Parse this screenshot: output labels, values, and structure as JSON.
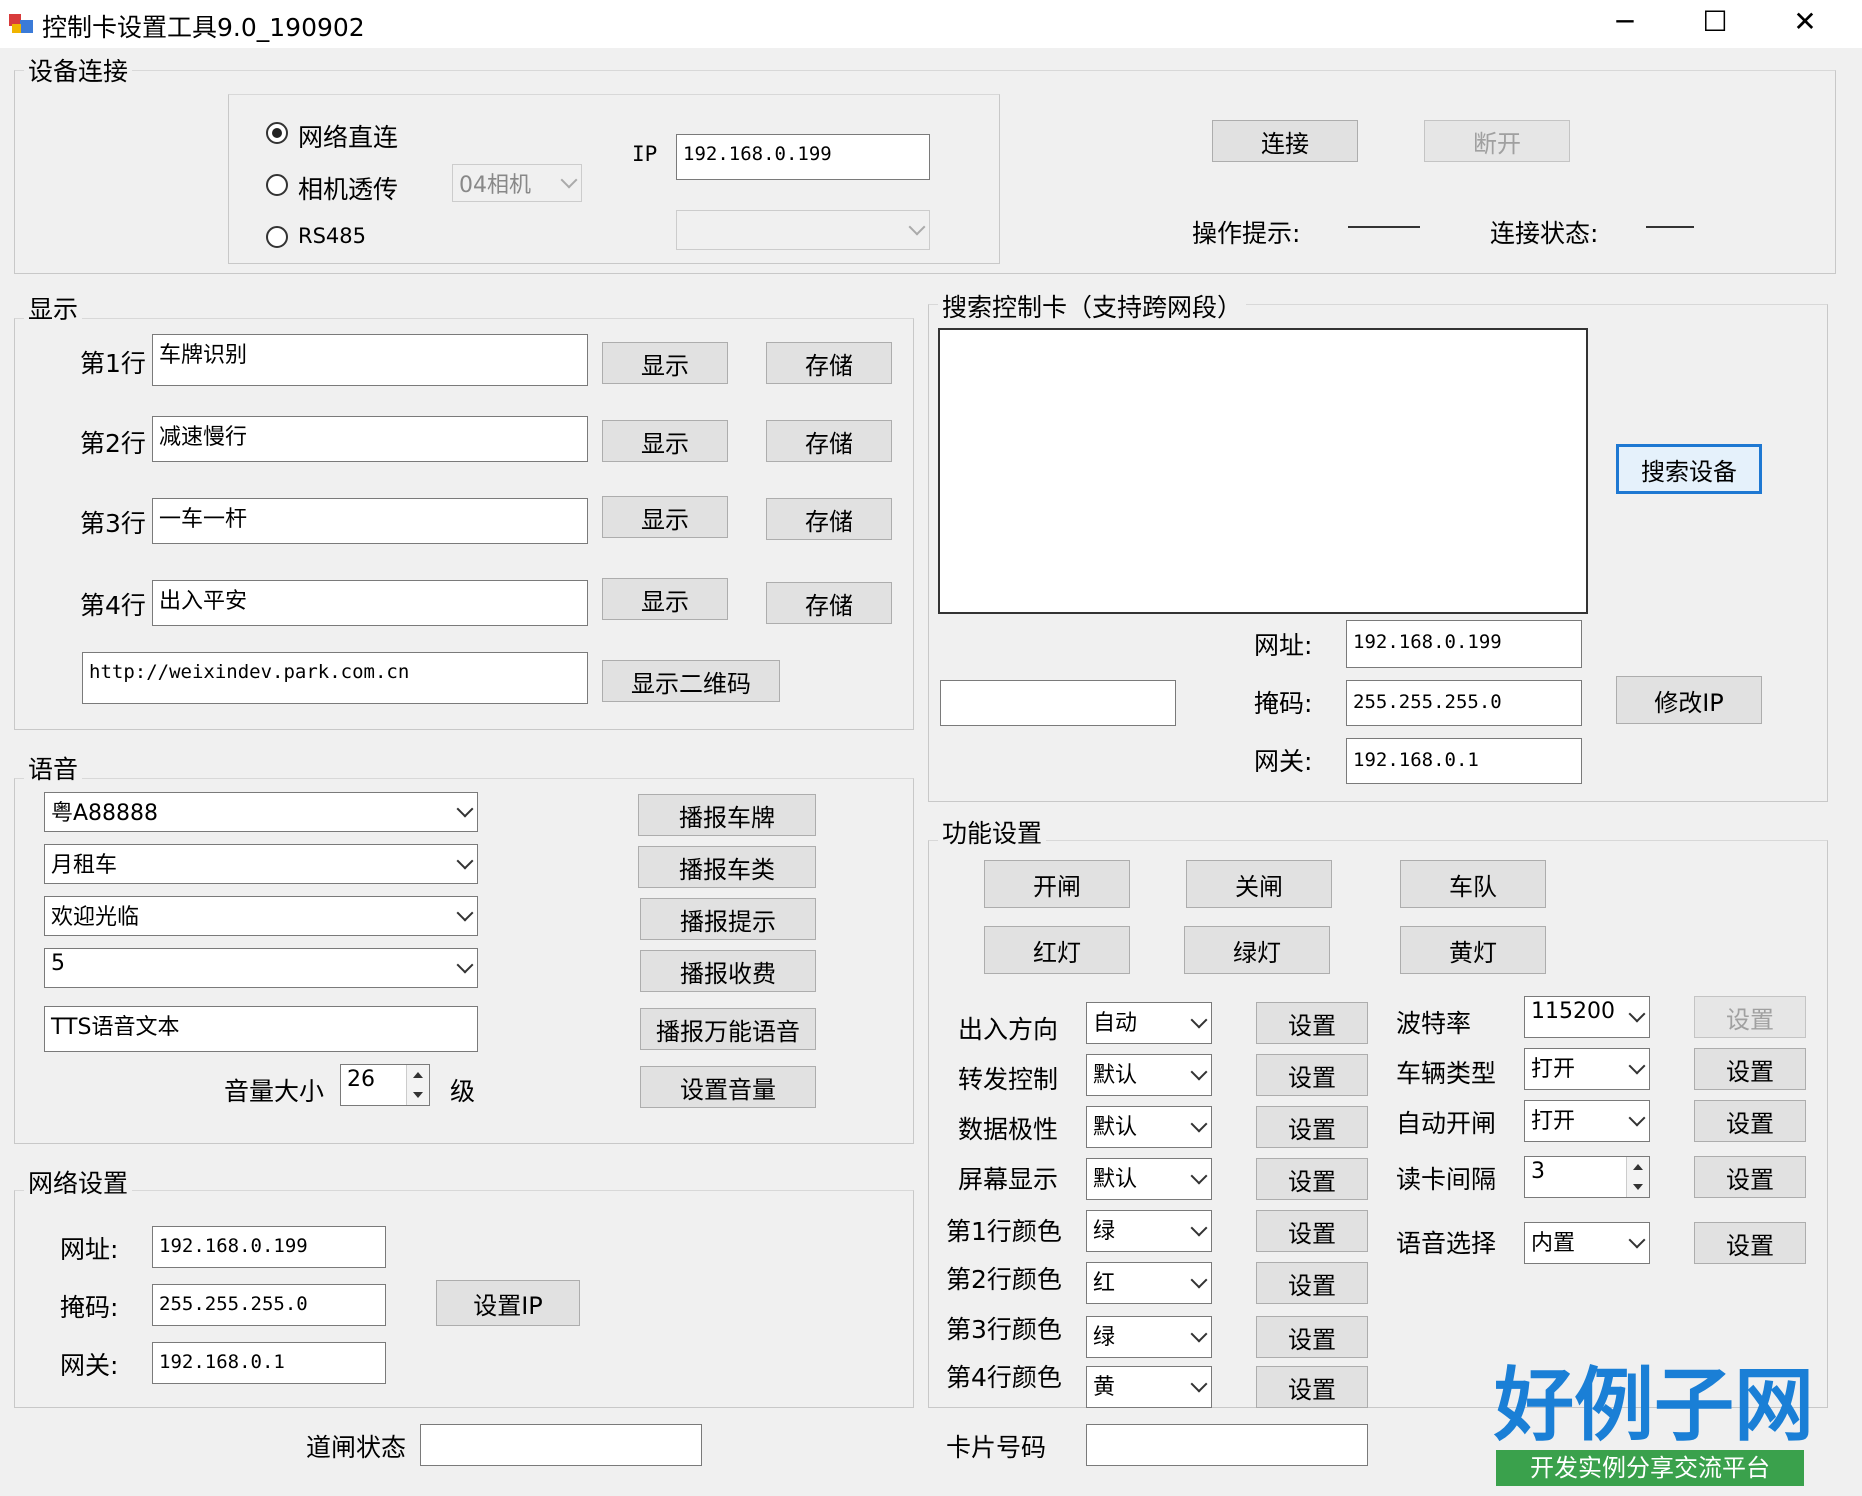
{
  "window": {
    "title": "控制卡设置工具9.0_190902",
    "minimize": "─",
    "maximize": "☐",
    "close": "✕"
  },
  "device_connection": {
    "group_label": "设备连接",
    "radio_network": "网络直连",
    "radio_camera": "相机透传",
    "radio_rs485": "RS485",
    "camera_select": "04相机",
    "ip_label": "IP",
    "ip_value": "192.168.0.199",
    "com_select": "",
    "connect_button": "连接",
    "disconnect_button": "断开",
    "op_hint_label": "操作提示:",
    "op_hint_value": "———",
    "conn_state_label": "连接状态:",
    "conn_state_value": "——"
  },
  "display": {
    "group_label": "显示",
    "rows": [
      {
        "label": "第1行",
        "value": "车牌识别",
        "show": "显示",
        "save": "存储"
      },
      {
        "label": "第2行",
        "value": "减速慢行",
        "show": "显示",
        "save": "存储"
      },
      {
        "label": "第3行",
        "value": "一车一杆",
        "show": "显示",
        "save": "存储"
      },
      {
        "label": "第4行",
        "value": "出入平安",
        "show": "显示",
        "save": "存储"
      }
    ],
    "qr_url": "http://weixindev.park.com.cn",
    "qr_button": "显示二维码"
  },
  "voice": {
    "group_label": "语音",
    "plate_select": "粤A88888",
    "type_select": "月租车",
    "hint_select": "欢迎光临",
    "fee_select": "5",
    "tts_text": "TTS语音文本",
    "btn_plate": "播报车牌",
    "btn_type": "播报车类",
    "btn_hint": "播报提示",
    "btn_fee": "播报收费",
    "btn_universal": "播报万能语音",
    "volume_label": "音量大小",
    "volume_value": "26",
    "volume_unit": "级",
    "btn_volume": "设置音量"
  },
  "network": {
    "group_label": "网络设置",
    "addr_label": "网址:",
    "addr_value": "192.168.0.199",
    "mask_label": "掩码:",
    "mask_value": "255.255.255.0",
    "gw_label": "网关:",
    "gw_value": "192.168.0.1",
    "set_ip_button": "设置IP"
  },
  "gate_status": {
    "label": "道闸状态",
    "value": ""
  },
  "search": {
    "group_label": "搜索控制卡（支持跨网段）",
    "search_button": "搜索设备",
    "extra_value": "",
    "addr_label": "网址:",
    "addr_value": "192.168.0.199",
    "mask_label": "掩码:",
    "mask_value": "255.255.255.0",
    "gw_label": "网关:",
    "gw_value": "192.168.0.1",
    "modify_button": "修改IP"
  },
  "functions": {
    "group_label": "功能设置",
    "btn_open": "开闸",
    "btn_close": "关闸",
    "btn_queue": "车队",
    "btn_red": "红灯",
    "btn_green": "绿灯",
    "btn_yellow": "黄灯",
    "left_rows": [
      {
        "label": "出入方向",
        "value": "自动",
        "button": "设置"
      },
      {
        "label": "转发控制",
        "value": "默认",
        "button": "设置"
      },
      {
        "label": "数据极性",
        "value": "默认",
        "button": "设置"
      },
      {
        "label": "屏幕显示",
        "value": "默认",
        "button": "设置"
      },
      {
        "label": "第1行颜色",
        "value": "绿",
        "button": "设置"
      },
      {
        "label": "第2行颜色",
        "value": "红",
        "button": "设置"
      },
      {
        "label": "第3行颜色",
        "value": "绿",
        "button": "设置"
      },
      {
        "label": "第4行颜色",
        "value": "黄",
        "button": "设置"
      }
    ],
    "right_rows": [
      {
        "label": "波特率",
        "value": "115200",
        "button": "设置"
      },
      {
        "label": "车辆类型",
        "value": "打开",
        "button": "设置"
      },
      {
        "label": "自动开闸",
        "value": "打开",
        "button": "设置"
      },
      {
        "label": "读卡间隔",
        "value": "3",
        "button": "设置"
      },
      {
        "label": "语音选择",
        "value": "内置",
        "button": "设置"
      }
    ],
    "card_label": "卡片号码",
    "card_value": ""
  },
  "watermark": {
    "logo": "好例子网",
    "tagline": "开发实例分享交流平台"
  }
}
